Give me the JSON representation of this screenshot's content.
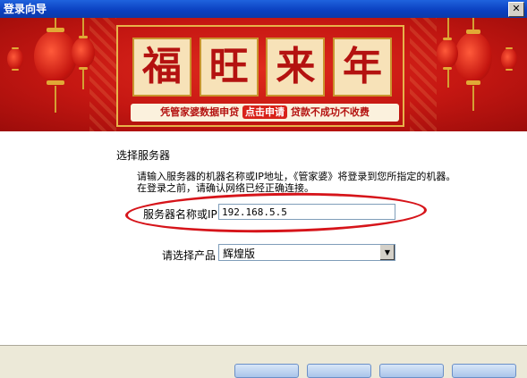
{
  "window": {
    "title": "登录向导",
    "close_glyph": "✕"
  },
  "banner": {
    "characters": [
      "福",
      "旺",
      "来",
      "年"
    ],
    "slogan_before": "凭管家婆数据申贷",
    "slogan_highlight": "点击申请",
    "slogan_after": "贷款不成功不收费"
  },
  "main": {
    "section_title": "选择服务器",
    "instructions_line1": "请输入服务器的机器名称或IP地址，《管家婆》将登录到您所指定的机器。",
    "instructions_line2": "在登录之前，请确认网络已经正确连接。",
    "server_label": "服务器名称或IP",
    "server_value": "192.168.5.5",
    "product_label": "请选择产品",
    "product_value": "辉煌版"
  },
  "colors": {
    "title_bar": "#0a3fbf",
    "banner_red": "#c51712",
    "annotation_ring": "#d6141a"
  }
}
